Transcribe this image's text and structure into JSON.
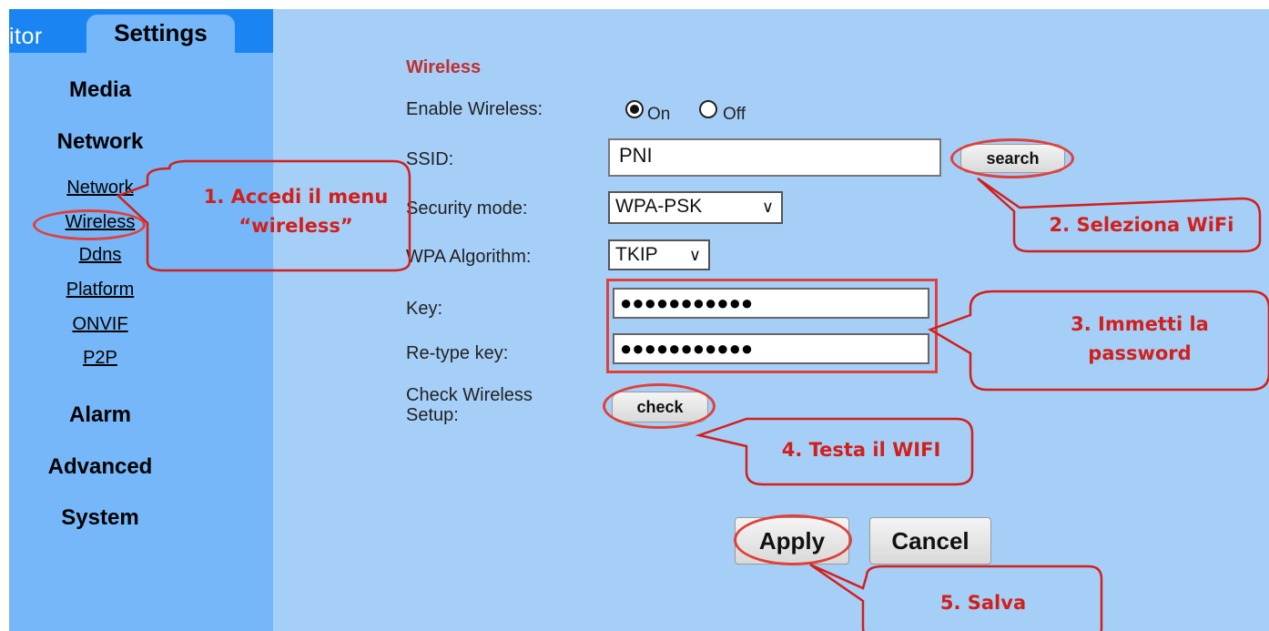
{
  "tabs": {
    "monitor": "itor",
    "settings": "Settings"
  },
  "sidebar": {
    "categories": [
      "Media",
      "Network",
      "Alarm",
      "Advanced",
      "System"
    ],
    "network_items": [
      "Network",
      "Wireless",
      "Ddns",
      "Platform",
      "ONVIF",
      "P2P"
    ]
  },
  "form": {
    "section_title": "Wireless",
    "enable_label": "Enable Wireless:",
    "on_label": "On",
    "off_label": "Off",
    "enable_value": "On",
    "ssid_label": "SSID:",
    "ssid_value": "PNI",
    "search_button": "search",
    "security_label": "Security mode:",
    "security_value": "WPA-PSK",
    "algorithm_label": "WPA Algorithm:",
    "algorithm_value": "TKIP",
    "key_label": "Key:",
    "key_value": "●●●●●●●●●●●",
    "retype_label": "Re-type key:",
    "retype_value": "●●●●●●●●●●●",
    "check_label_line1": "Check Wireless",
    "check_label_line2": "Setup:",
    "check_button": "check",
    "apply_button": "Apply",
    "cancel_button": "Cancel"
  },
  "callouts": {
    "c1_line1": "1. Accedi il menu",
    "c1_line2": "“wireless”",
    "c2": "2. Seleziona WiFi",
    "c3_line1": "3. Immetti la",
    "c3_line2": "password",
    "c4": "4. Testa il WIFI",
    "c5": "5. Salva"
  },
  "colors": {
    "tab_bar": "#1a85f2",
    "sidebar": "#75b7f8",
    "panel": "#a6cff8",
    "annotation_red": "#d31f1a",
    "section_title": "#c0302d"
  }
}
